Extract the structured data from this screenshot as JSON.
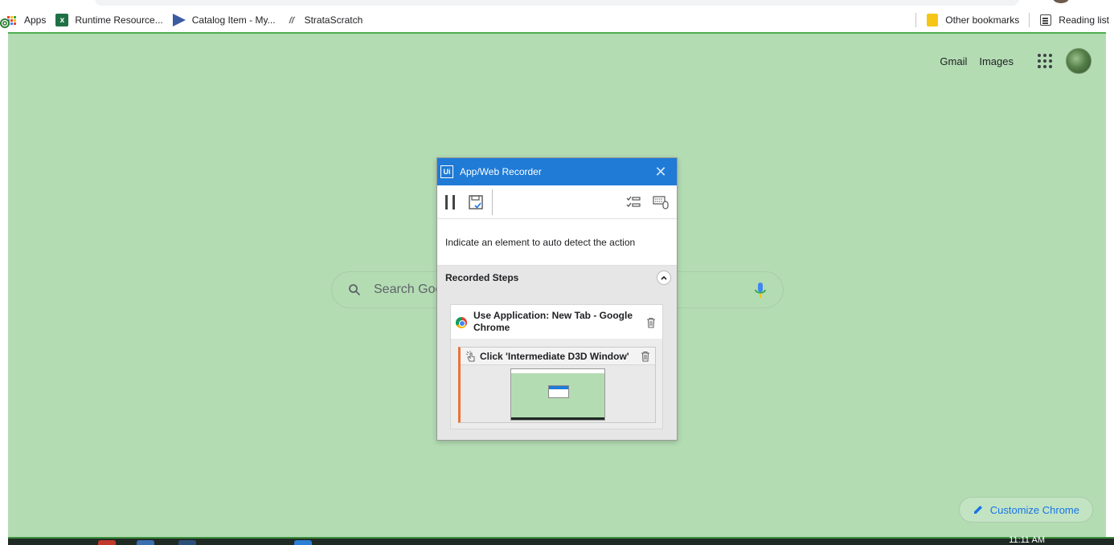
{
  "bookmarks": {
    "items": [
      {
        "label": "Apps",
        "icon": "apps-grid-icon"
      },
      {
        "label": "Runtime Resource...",
        "icon": "excel-icon"
      },
      {
        "label": "Catalog Item - My...",
        "icon": "servicenow-icon"
      },
      {
        "label": "StrataScratch",
        "icon": "stratascratch-icon"
      }
    ],
    "other_bookmarks": "Other bookmarks",
    "reading_list": "Reading list"
  },
  "google": {
    "gmail": "Gmail",
    "images": "Images",
    "search_placeholder": "Search Goo",
    "customize": "Customize Chrome"
  },
  "recorder": {
    "title": "App/Web Recorder",
    "logo_text": "Ui",
    "close_glyph": "✕",
    "hint": "Indicate an element to auto detect the action",
    "recorded_steps_label": "Recorded Steps",
    "steps": [
      {
        "title": "Use Application: New Tab - Google Chrome",
        "children": [
          {
            "title": "Click 'Intermediate D3D Window'"
          }
        ]
      }
    ]
  },
  "taskbar": {
    "time": "11:11 AM"
  },
  "colors": {
    "page_bg": "#b3dcb3",
    "recorder_titlebar": "#1f7bd6",
    "step_accent": "#e8743b",
    "link_blue": "#1a73e8"
  }
}
